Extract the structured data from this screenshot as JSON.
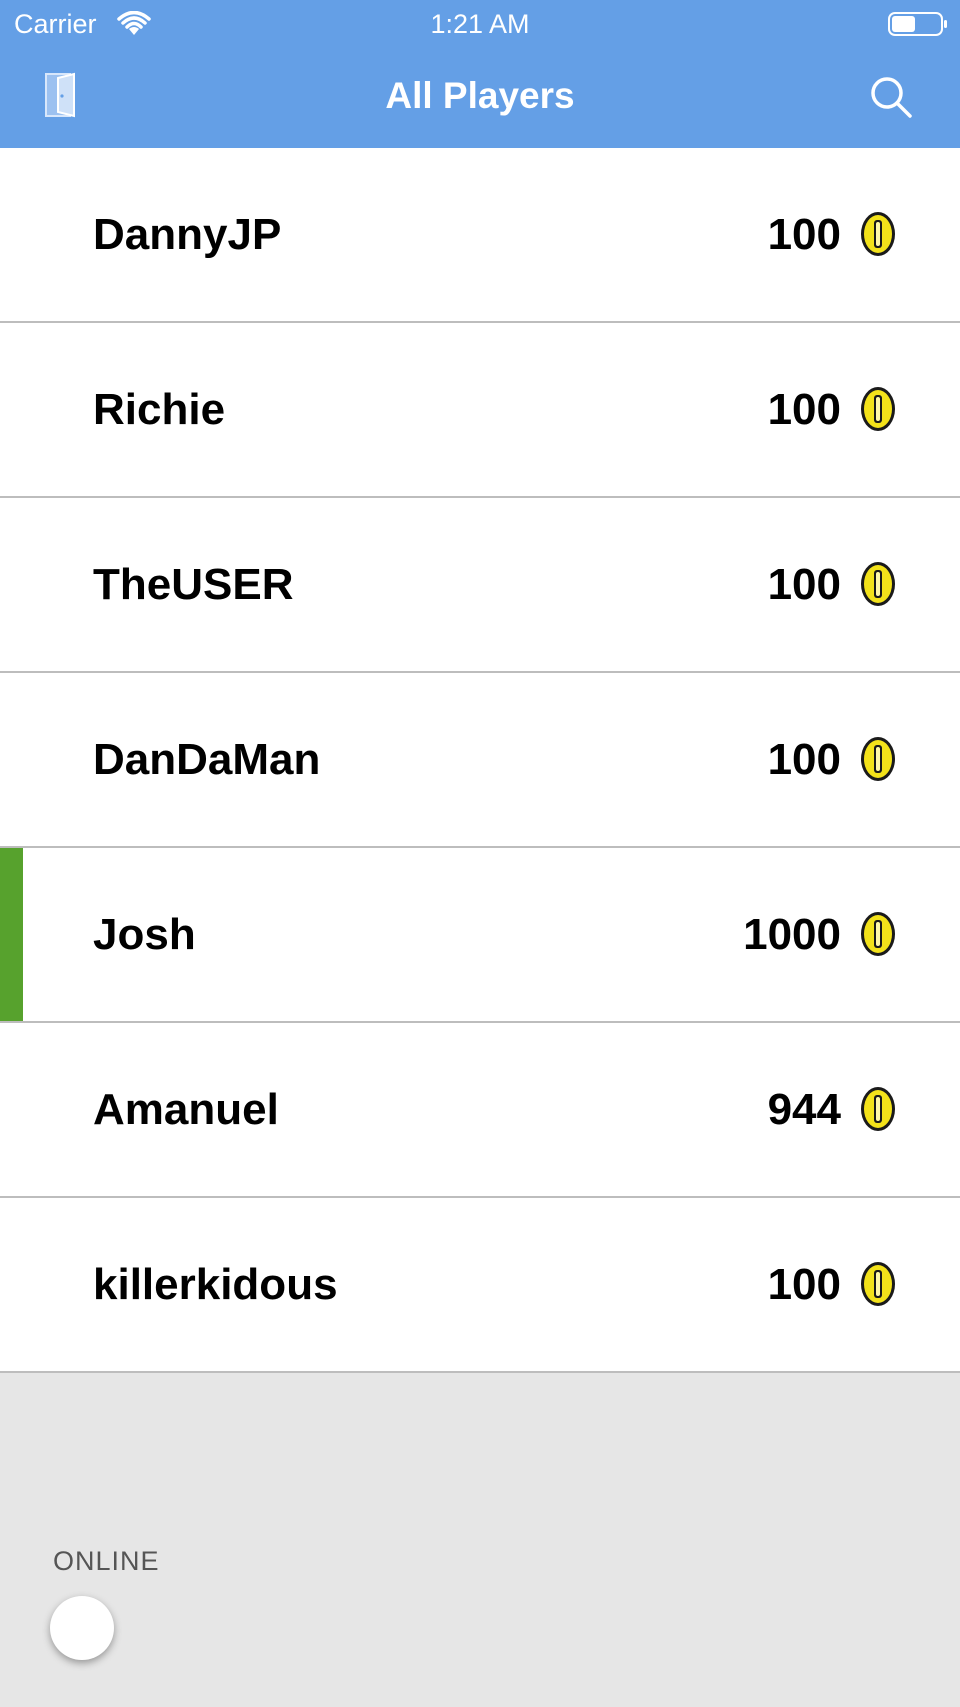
{
  "status_bar": {
    "carrier": "Carrier",
    "time": "1:21 AM"
  },
  "nav": {
    "title": "All Players",
    "left_icon": "exit-door-icon",
    "right_icon": "search-icon"
  },
  "players": [
    {
      "name": "DannyJP",
      "coins": "100",
      "selected": false
    },
    {
      "name": "Richie",
      "coins": "100",
      "selected": false
    },
    {
      "name": "TheUSER",
      "coins": "100",
      "selected": false
    },
    {
      "name": "DanDaMan",
      "coins": "100",
      "selected": false
    },
    {
      "name": "Josh",
      "coins": "1000",
      "selected": true
    },
    {
      "name": "Amanuel",
      "coins": "944",
      "selected": false
    },
    {
      "name": "killerkidous",
      "coins": "100",
      "selected": false
    }
  ],
  "footer": {
    "online_label": "ONLINE",
    "online_enabled": false
  },
  "colors": {
    "header": "#649fe6",
    "selected_marker": "#57a22d",
    "coin": "#f3e21a"
  }
}
